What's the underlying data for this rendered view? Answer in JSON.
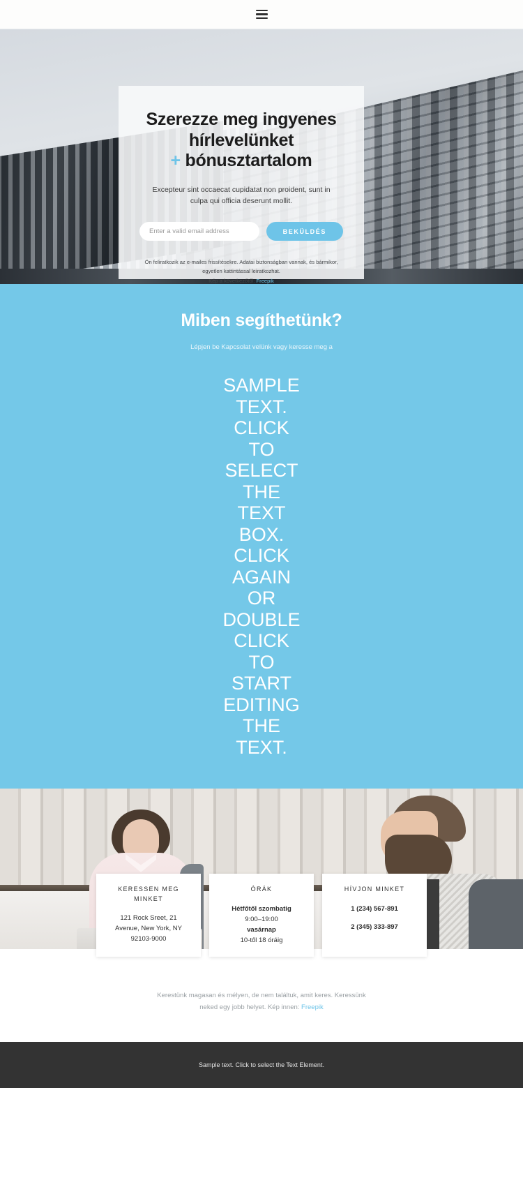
{
  "nav": {
    "menu_icon": "hamburger-menu-icon"
  },
  "hero": {
    "heading_line1": "Szerezze meg ingyenes",
    "heading_line2": "hírlevelünket",
    "plus": "+",
    "heading_line3": "bónusztartalom",
    "subtitle": "Excepteur sint occaecat cupidatat non proident, sunt in culpa qui officia deserunt mollit.",
    "email_placeholder": "Enter a valid email address",
    "email_value": "",
    "submit_label": "BEKÜLDÉS",
    "fine_line1": "Ön feliratkozik az e-mailes frissítésekre. Adatai biztonságban vannak, és bármikor,",
    "fine_line2": "egyetlen kattintással leiratkozhat.",
    "fine_line3": "Kép a következőtől:",
    "fine_link": "Freepik",
    "accent_color": "#6ec4e8"
  },
  "blue_section": {
    "heading": "Miben segíthetünk?",
    "subtitle": "Lépjen be Kapcsolat velünk vagy keresse meg a",
    "sample_text": "SAMPLE TEXT. CLICK TO SELECT THE TEXT BOX. CLICK AGAIN OR DOUBLE CLICK TO START EDITING THE TEXT.",
    "background_color": "#74c8e8"
  },
  "cards": [
    {
      "title": "KERESSEN MEG MINKET",
      "line1": "121 Rock Sreet, 21",
      "line2": "Avenue, New York, NY",
      "line3": "92103-9000"
    },
    {
      "title": "ÓRÁK",
      "line1": "Hétfőtől szombatig",
      "line2": "9:00–19:00",
      "line3": "vasárnap",
      "line4": "10-től 18 óráig"
    },
    {
      "title": "HÍVJON MINKET",
      "line1": "1 (234) 567-891",
      "line2": "2 (345) 333-897"
    }
  ],
  "note": {
    "line1": "Kerestünk magasan és mélyen, de nem találtuk, amit keres. Keressünk",
    "line2": "neked egy jobb helyet. Kép innen:",
    "link": "Freepik"
  },
  "footer": {
    "text": "Sample text. Click to select the Text Element."
  }
}
